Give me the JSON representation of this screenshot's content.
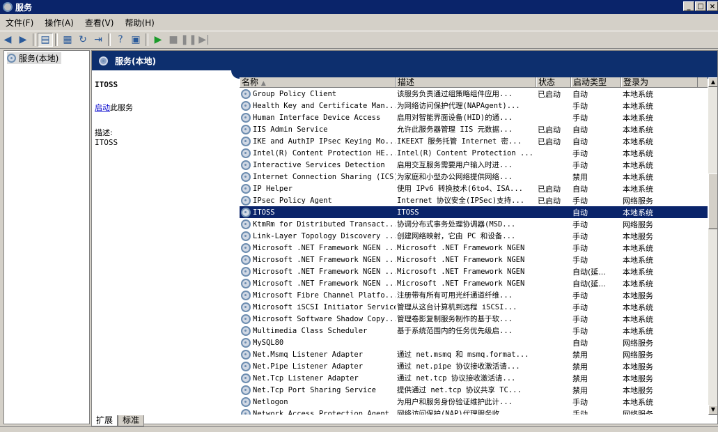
{
  "window": {
    "title": "服务",
    "min": "_",
    "max": "□",
    "close": "×"
  },
  "menu": [
    "文件(F)",
    "操作(A)",
    "查看(V)",
    "帮助(H)"
  ],
  "tree": {
    "root": "服务(本地)"
  },
  "header": {
    "title": "服务(本地)"
  },
  "details": {
    "service_name": "ITOSS",
    "start_link": "启动",
    "start_suffix": "此服务",
    "desc_label": "描述:",
    "desc_value": "ITOSS"
  },
  "columns": [
    "名称",
    "描述",
    "状态",
    "启动类型",
    "登录为"
  ],
  "rows": [
    {
      "name": "Group Policy Client",
      "desc": "该服务负责通过组策略组件应用...",
      "status": "已启动",
      "startup": "自动",
      "logon": "本地系统"
    },
    {
      "name": "Health Key and Certificate Man...",
      "desc": "为网络访问保护代理(NAPAgent)...",
      "status": "",
      "startup": "手动",
      "logon": "本地系统"
    },
    {
      "name": "Human Interface Device Access",
      "desc": "启用对智能界面设备(HID)的通...",
      "status": "",
      "startup": "手动",
      "logon": "本地系统"
    },
    {
      "name": "IIS Admin Service",
      "desc": "允许此服务器管理 IIS 元数据...",
      "status": "已启动",
      "startup": "自动",
      "logon": "本地系统"
    },
    {
      "name": "IKE and AuthIP IPsec Keying Mo...",
      "desc": "IKEEXT 服务托管 Internet 密...",
      "status": "已启动",
      "startup": "自动",
      "logon": "本地系统"
    },
    {
      "name": "Intel(R) Content Protection HE...",
      "desc": "Intel(R) Content Protection ...",
      "status": "",
      "startup": "手动",
      "logon": "本地系统"
    },
    {
      "name": "Interactive Services Detection",
      "desc": "启用交互服务需要用户输入时进...",
      "status": "",
      "startup": "手动",
      "logon": "本地系统"
    },
    {
      "name": "Internet Connection Sharing (ICS)",
      "desc": "为家庭和小型办公网络提供网络...",
      "status": "",
      "startup": "禁用",
      "logon": "本地系统"
    },
    {
      "name": "IP Helper",
      "desc": "使用 IPv6 转换技术(6to4、ISA...",
      "status": "已启动",
      "startup": "自动",
      "logon": "本地系统"
    },
    {
      "name": "IPsec Policy Agent",
      "desc": "Internet 协议安全(IPSec)支持...",
      "status": "已启动",
      "startup": "手动",
      "logon": "网络服务"
    },
    {
      "name": "ITOSS",
      "desc": "ITOSS",
      "status": "",
      "startup": "自动",
      "logon": "本地系统",
      "selected": true
    },
    {
      "name": "KtmRm for Distributed Transact...",
      "desc": "协调分布式事务处理协调器(MSD...",
      "status": "",
      "startup": "手动",
      "logon": "网络服务"
    },
    {
      "name": "Link-Layer Topology Discovery ...",
      "desc": "创建网络映射，它由 PC 和设备...",
      "status": "",
      "startup": "手动",
      "logon": "本地服务"
    },
    {
      "name": "Microsoft .NET Framework NGEN ...",
      "desc": "Microsoft .NET Framework NGEN",
      "status": "",
      "startup": "手动",
      "logon": "本地系统"
    },
    {
      "name": "Microsoft .NET Framework NGEN ...",
      "desc": "Microsoft .NET Framework NGEN",
      "status": "",
      "startup": "手动",
      "logon": "本地系统"
    },
    {
      "name": "Microsoft .NET Framework NGEN ...",
      "desc": "Microsoft .NET Framework NGEN",
      "status": "",
      "startup": "自动(延...",
      "logon": "本地系统"
    },
    {
      "name": "Microsoft .NET Framework NGEN ...",
      "desc": "Microsoft .NET Framework NGEN",
      "status": "",
      "startup": "自动(延...",
      "logon": "本地系统"
    },
    {
      "name": "Microsoft Fibre Channel Platfo...",
      "desc": "注册带有所有可用光纤通道纤维...",
      "status": "",
      "startup": "手动",
      "logon": "本地服务"
    },
    {
      "name": "Microsoft iSCSI Initiator Service",
      "desc": "管理从这台计算机到远程 iSCSI...",
      "status": "",
      "startup": "手动",
      "logon": "本地系统"
    },
    {
      "name": "Microsoft Software Shadow Copy...",
      "desc": "管理卷影复制服务制作的基于软...",
      "status": "",
      "startup": "手动",
      "logon": "本地系统"
    },
    {
      "name": "Multimedia Class Scheduler",
      "desc": "基于系统范围内的任务优先级启...",
      "status": "",
      "startup": "手动",
      "logon": "本地系统"
    },
    {
      "name": "MySQL80",
      "desc": "",
      "status": "",
      "startup": "自动",
      "logon": "网络服务"
    },
    {
      "name": "Net.Msmq Listener Adapter",
      "desc": "通过 net.msmq 和 msmq.format...",
      "status": "",
      "startup": "禁用",
      "logon": "网络服务"
    },
    {
      "name": "Net.Pipe Listener Adapter",
      "desc": "通过 net.pipe 协议接收激活请...",
      "status": "",
      "startup": "禁用",
      "logon": "本地服务"
    },
    {
      "name": "Net.Tcp Listener Adapter",
      "desc": "通过 net.tcp 协议接收激活请...",
      "status": "",
      "startup": "禁用",
      "logon": "本地服务"
    },
    {
      "name": "Net.Tcp Port Sharing Service",
      "desc": "提供通过 net.tcp 协议共享 TC...",
      "status": "",
      "startup": "禁用",
      "logon": "本地服务"
    },
    {
      "name": "Netlogon",
      "desc": "为用户和服务身份验证维护此计...",
      "status": "",
      "startup": "手动",
      "logon": "本地系统"
    },
    {
      "name": "Network Access Protection Agent",
      "desc": "网络访问保护(NAP)代理服务收...",
      "status": "",
      "startup": "手动",
      "logon": "网络服务"
    }
  ],
  "tabs": [
    "扩展",
    "标准"
  ],
  "icons": {
    "back": "arrow-left-icon",
    "forward": "arrow-right-icon",
    "console-tree": "console-tree-icon",
    "properties": "properties-icon",
    "refresh": "refresh-icon",
    "export": "export-list-icon",
    "help": "help-icon",
    "show-hide": "show-hide-icon",
    "start": "play-icon",
    "stop": "stop-icon",
    "pause": "pause-icon",
    "restart": "restart-icon"
  },
  "colors": {
    "title_bg": "#0a246a",
    "header_bg": "#0d2f6e",
    "selection": "#0a246a"
  }
}
